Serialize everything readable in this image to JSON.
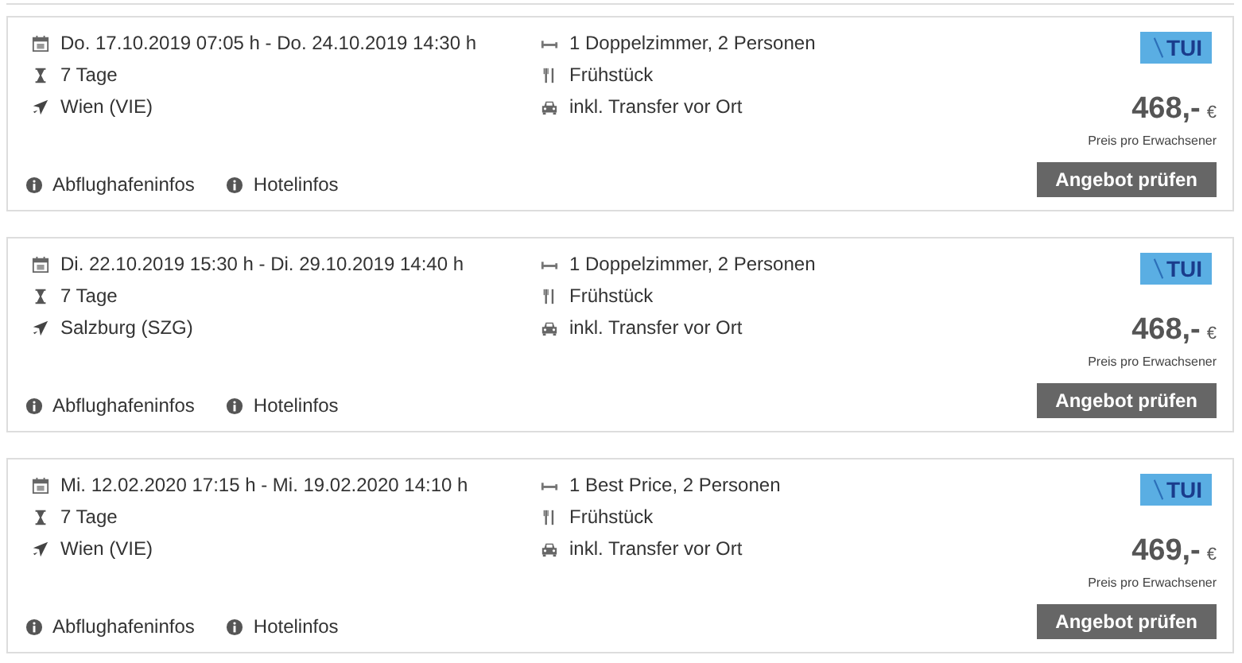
{
  "offers": [
    {
      "dates": "Do. 17.10.2019 07:05 h - Do. 24.10.2019 14:30 h",
      "duration": "7 Tage",
      "airport": "Wien (VIE)",
      "room": "1 Doppelzimmer, 2 Personen",
      "board": "Frühstück",
      "transfer": "inkl. Transfer vor Ort",
      "operator": "TUI",
      "price": "468,-",
      "currency": "€",
      "price_note": "Preis pro Erwachsener",
      "button": "Angebot prüfen",
      "links": [
        "Abflughafeninfos",
        "Hotelinfos"
      ]
    },
    {
      "dates": "Di. 22.10.2019 15:30 h - Di. 29.10.2019 14:40 h",
      "duration": "7 Tage",
      "airport": "Salzburg (SZG)",
      "room": "1 Doppelzimmer, 2 Personen",
      "board": "Frühstück",
      "transfer": "inkl. Transfer vor Ort",
      "operator": "TUI",
      "price": "468,-",
      "currency": "€",
      "price_note": "Preis pro Erwachsener",
      "button": "Angebot prüfen",
      "links": [
        "Abflughafeninfos",
        "Hotelinfos"
      ]
    },
    {
      "dates": "Mi. 12.02.2020 17:15 h - Mi. 19.02.2020 14:10 h",
      "duration": "7 Tage",
      "airport": "Wien (VIE)",
      "room": "1 Best Price, 2 Personen",
      "board": "Frühstück",
      "transfer": "inkl. Transfer vor Ort",
      "operator": "TUI",
      "price": "469,-",
      "currency": "€",
      "price_note": "Preis pro Erwachsener",
      "button": "Angebot prüfen",
      "links": [
        "Abflughafeninfos",
        "Hotelinfos"
      ]
    }
  ]
}
